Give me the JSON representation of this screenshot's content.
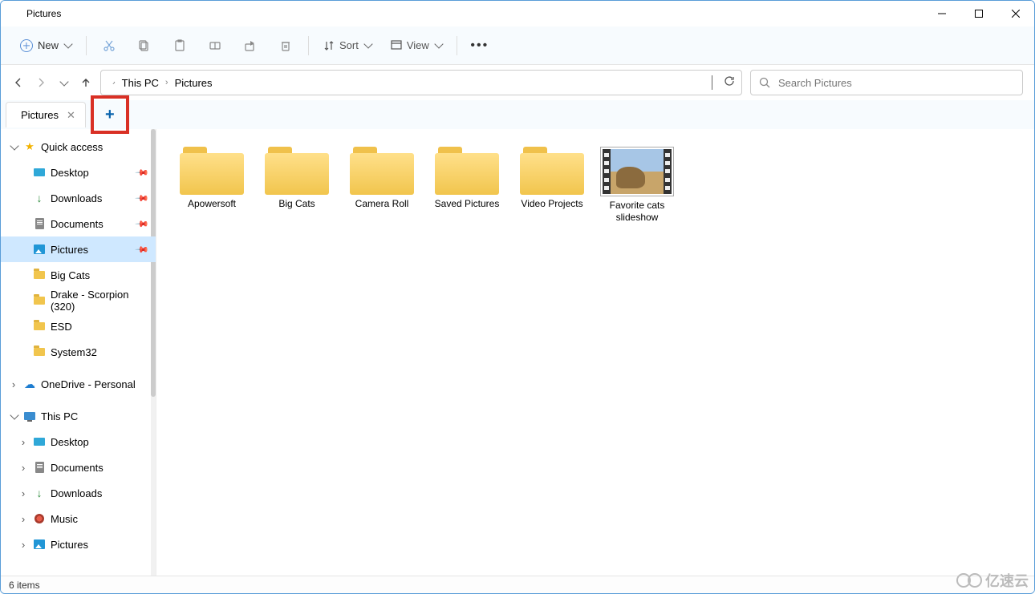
{
  "window": {
    "title": "Pictures"
  },
  "toolbar": {
    "new_label": "New",
    "sort_label": "Sort",
    "view_label": "View"
  },
  "breadcrumbs": [
    "This PC",
    "Pictures"
  ],
  "search": {
    "placeholder": "Search Pictures"
  },
  "tab": {
    "label": "Pictures"
  },
  "sidebar": {
    "quick_access": {
      "label": "Quick access",
      "items": [
        {
          "label": "Desktop",
          "icon": "desktop",
          "pinned": true
        },
        {
          "label": "Downloads",
          "icon": "download",
          "pinned": true
        },
        {
          "label": "Documents",
          "icon": "document",
          "pinned": true
        },
        {
          "label": "Pictures",
          "icon": "pictures",
          "pinned": true,
          "selected": true
        },
        {
          "label": "Big Cats",
          "icon": "folder"
        },
        {
          "label": "Drake - Scorpion (320)",
          "icon": "folder"
        },
        {
          "label": "ESD",
          "icon": "folder"
        },
        {
          "label": "System32",
          "icon": "folder"
        }
      ]
    },
    "onedrive": {
      "label": "OneDrive - Personal"
    },
    "this_pc": {
      "label": "This PC",
      "items": [
        {
          "label": "Desktop",
          "icon": "desktop"
        },
        {
          "label": "Documents",
          "icon": "document"
        },
        {
          "label": "Downloads",
          "icon": "download"
        },
        {
          "label": "Music",
          "icon": "music"
        },
        {
          "label": "Pictures",
          "icon": "pictures"
        }
      ]
    }
  },
  "content": {
    "items": [
      {
        "label": "Apowersoft",
        "type": "folder"
      },
      {
        "label": "Big Cats",
        "type": "folder"
      },
      {
        "label": "Camera Roll",
        "type": "folder"
      },
      {
        "label": "Saved Pictures",
        "type": "folder"
      },
      {
        "label": "Video Projects",
        "type": "folder"
      },
      {
        "label": "Favorite cats slideshow",
        "type": "video"
      }
    ]
  },
  "status": {
    "text": "6 items"
  },
  "watermark": {
    "text": "亿速云"
  }
}
